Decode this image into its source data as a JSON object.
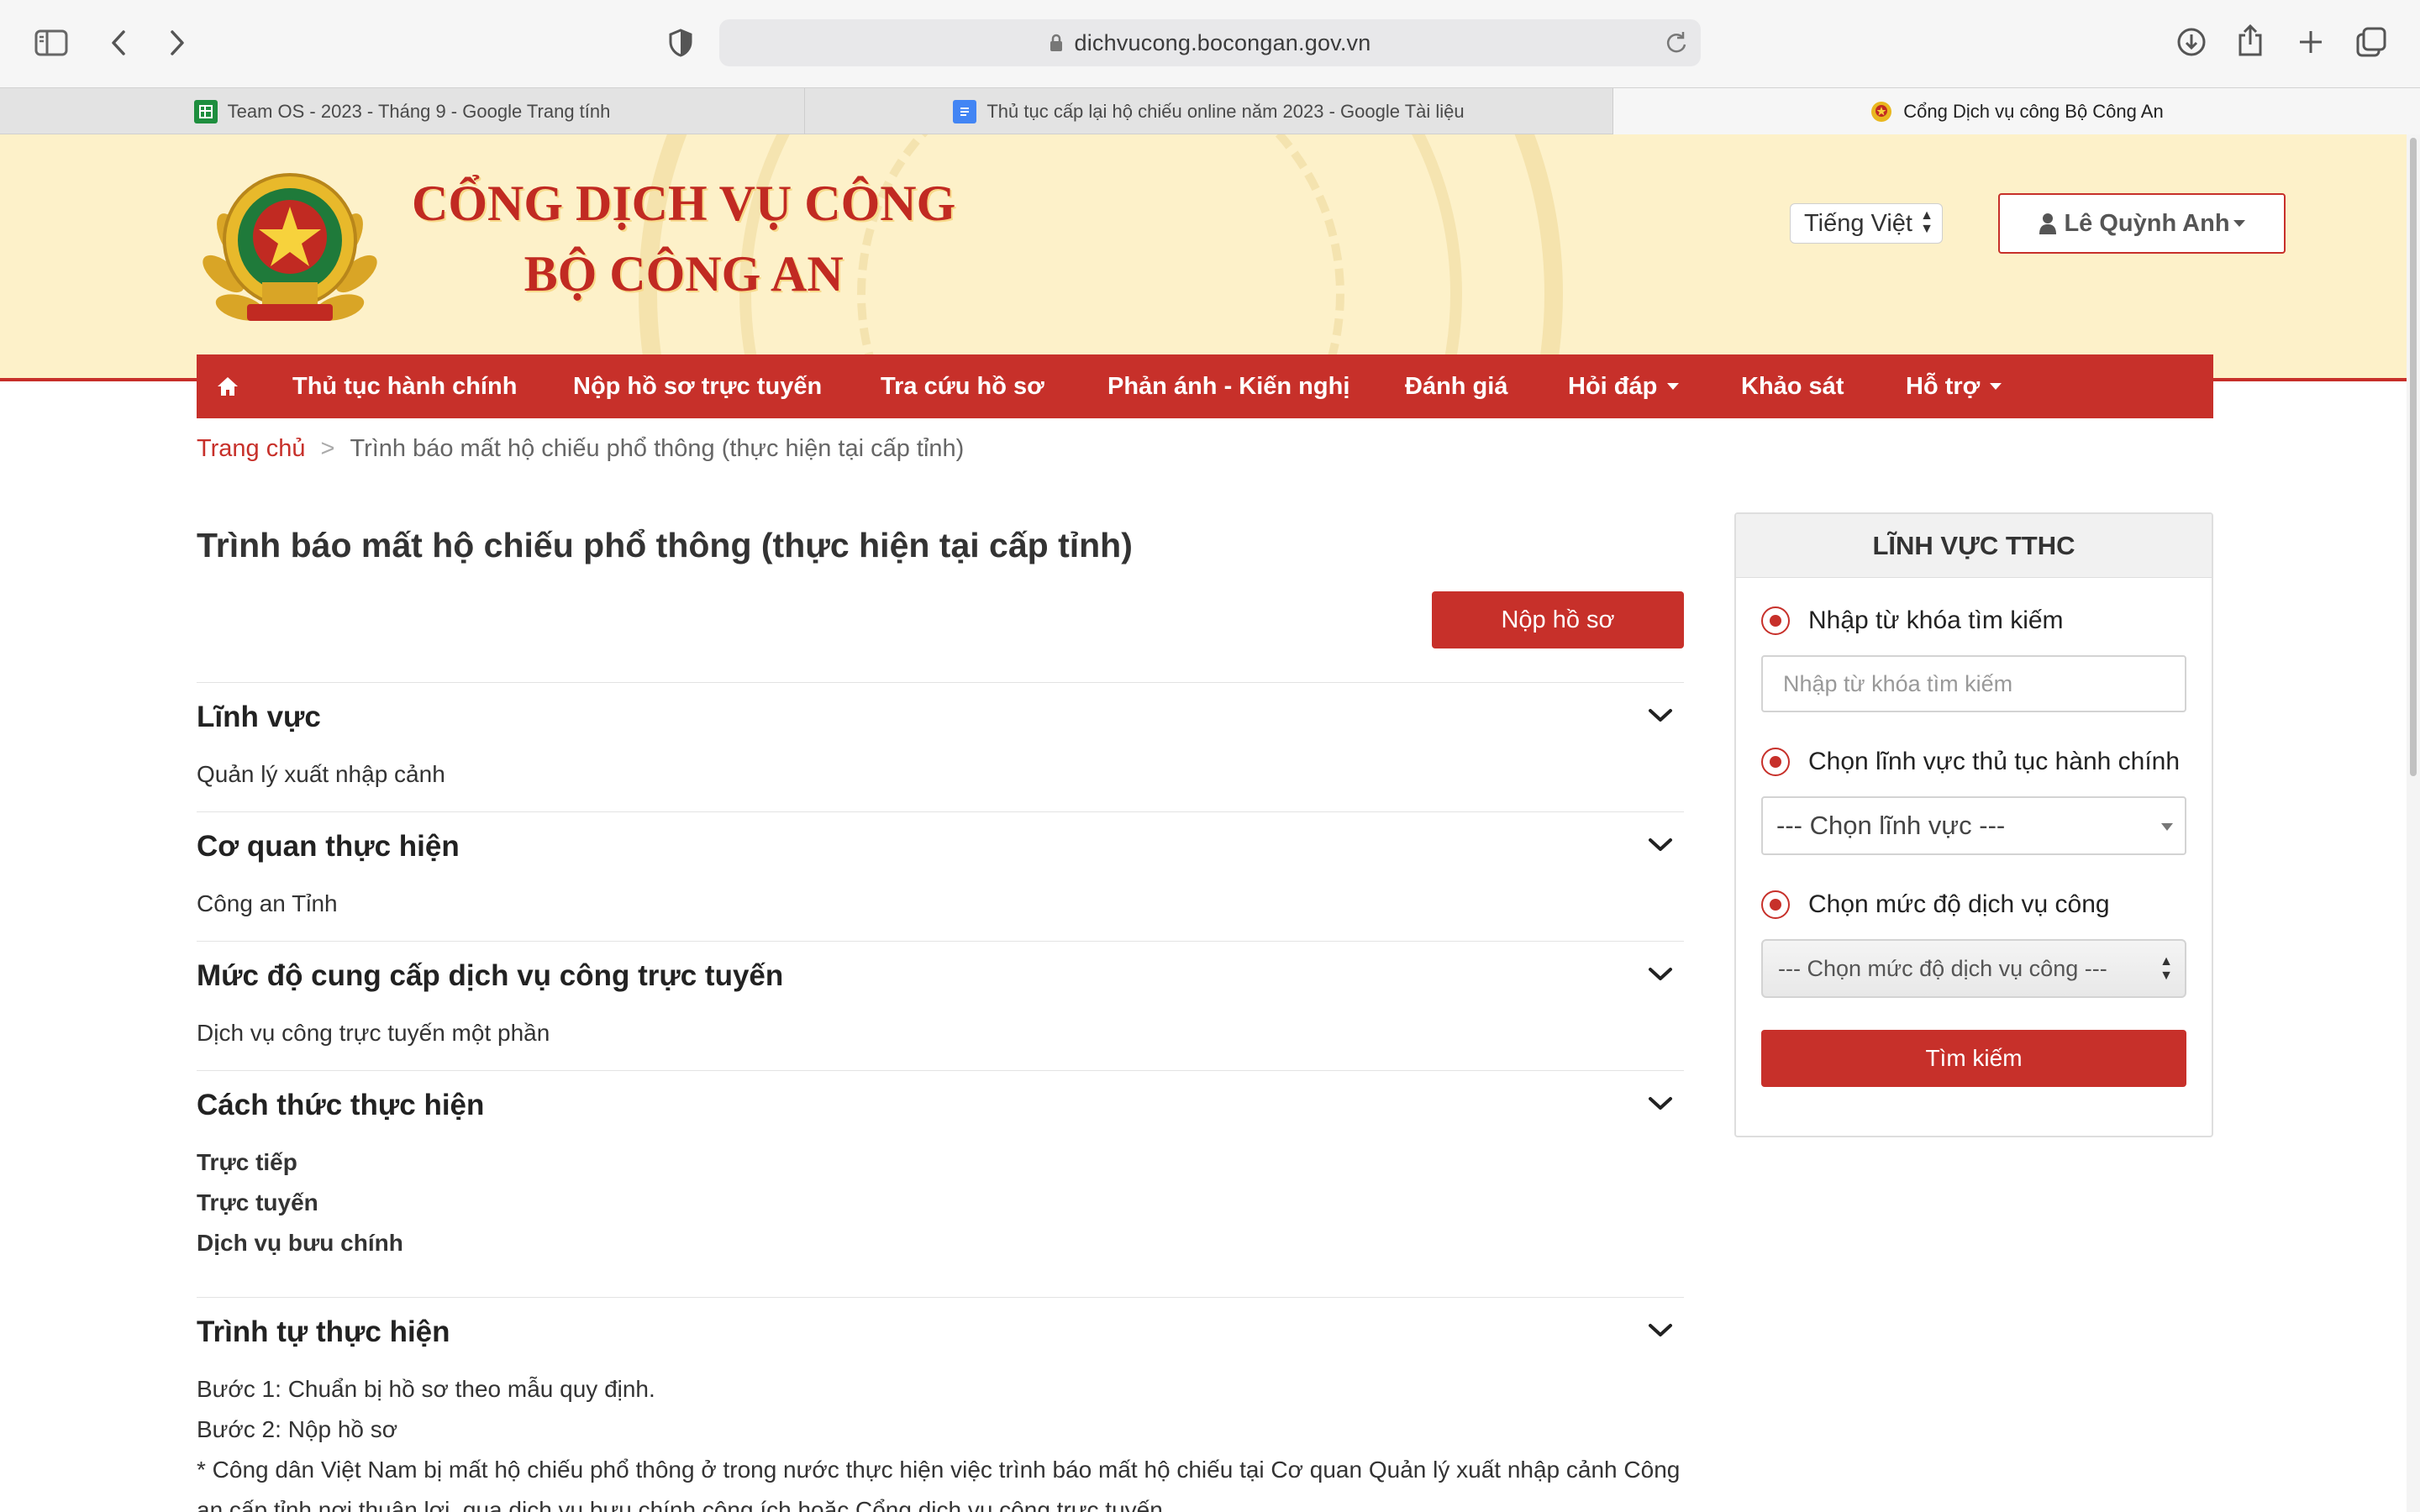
{
  "browser": {
    "url": "dichvucong.bocongan.gov.vn",
    "tabs": [
      {
        "title": "Team OS - 2023 - Tháng 9 - Google Trang tính",
        "favicon": "google-sheets-icon",
        "color": "#1e8e3e"
      },
      {
        "title": "Thủ tục cấp lại hộ chiếu online năm 2023 - Google Tài liệu",
        "favicon": "google-docs-icon",
        "color": "#4285f4"
      },
      {
        "title": "Cổng Dịch vụ công Bộ Công An",
        "favicon": "police-emblem-icon",
        "active": true
      }
    ]
  },
  "header": {
    "title_line1": "CỔNG DỊCH VỤ CÔNG",
    "title_line2": "BỘ CÔNG AN",
    "language": "Tiếng Việt",
    "user_name": "Lê Quỳnh Anh",
    "brand_red": "#c7302a",
    "header_bg": "#fdf1c9"
  },
  "nav": {
    "items": [
      {
        "label": "Thủ tục hành chính"
      },
      {
        "label": "Nộp hồ sơ trực tuyến"
      },
      {
        "label": "Tra cứu hồ sơ"
      },
      {
        "label": "Phản ánh - Kiến nghị"
      },
      {
        "label": "Đánh giá"
      },
      {
        "label": "Hỏi đáp"
      },
      {
        "label": "Khảo sát"
      },
      {
        "label": "Hỗ trợ"
      }
    ]
  },
  "breadcrumb": {
    "home": "Trang chủ",
    "separator": ">",
    "current": "Trình báo mất hộ chiếu phổ thông (thực hiện tại cấp tỉnh)"
  },
  "main": {
    "title": "Trình báo mất hộ chiếu phổ thông (thực hiện tại cấp tỉnh)",
    "submit_label": "Nộp hồ sơ",
    "sections": [
      {
        "heading": "Lĩnh vực",
        "lines": [
          "Quản lý xuất nhập cảnh"
        ]
      },
      {
        "heading": "Cơ quan thực hiện",
        "lines": [
          "Công an Tỉnh"
        ]
      },
      {
        "heading": "Mức độ cung cấp dịch vụ công trực tuyến",
        "lines": [
          "Dịch vụ công trực tuyến một phần"
        ]
      },
      {
        "heading": "Cách thức thực hiện",
        "lines": [
          "Trực tiếp",
          "Trực tuyến",
          "Dịch vụ bưu chính"
        ]
      },
      {
        "heading": "Trình tự thực hiện",
        "lines": [
          "Bước 1: Chuẩn bị hồ sơ theo mẫu quy định.",
          "Bước 2: Nộp hồ sơ",
          "* Công dân Việt Nam bị mất hộ chiếu phổ thông ở trong nước thực hiện việc trình báo mất hộ chiếu tại Cơ quan Quản lý xuất nhập cảnh Công",
          "an cấp tỉnh nơi thuận lợi, qua dịch vụ bưu chính công ích hoặc Cổng dịch vụ công trực tuyến."
        ]
      }
    ]
  },
  "sidebar": {
    "title": "LĨNH VỰC TTHC",
    "option_keyword": "Nhập từ khóa tìm kiếm",
    "keyword_placeholder": "Nhập từ khóa tìm kiếm",
    "option_field": "Chọn lĩnh vực thủ tục hành chính",
    "field_select": "--- Chọn lĩnh vực ---",
    "option_level": "Chọn mức độ dịch vụ công",
    "level_select": "--- Chọn mức độ dịch vụ công ---",
    "search_label": "Tìm kiếm"
  }
}
